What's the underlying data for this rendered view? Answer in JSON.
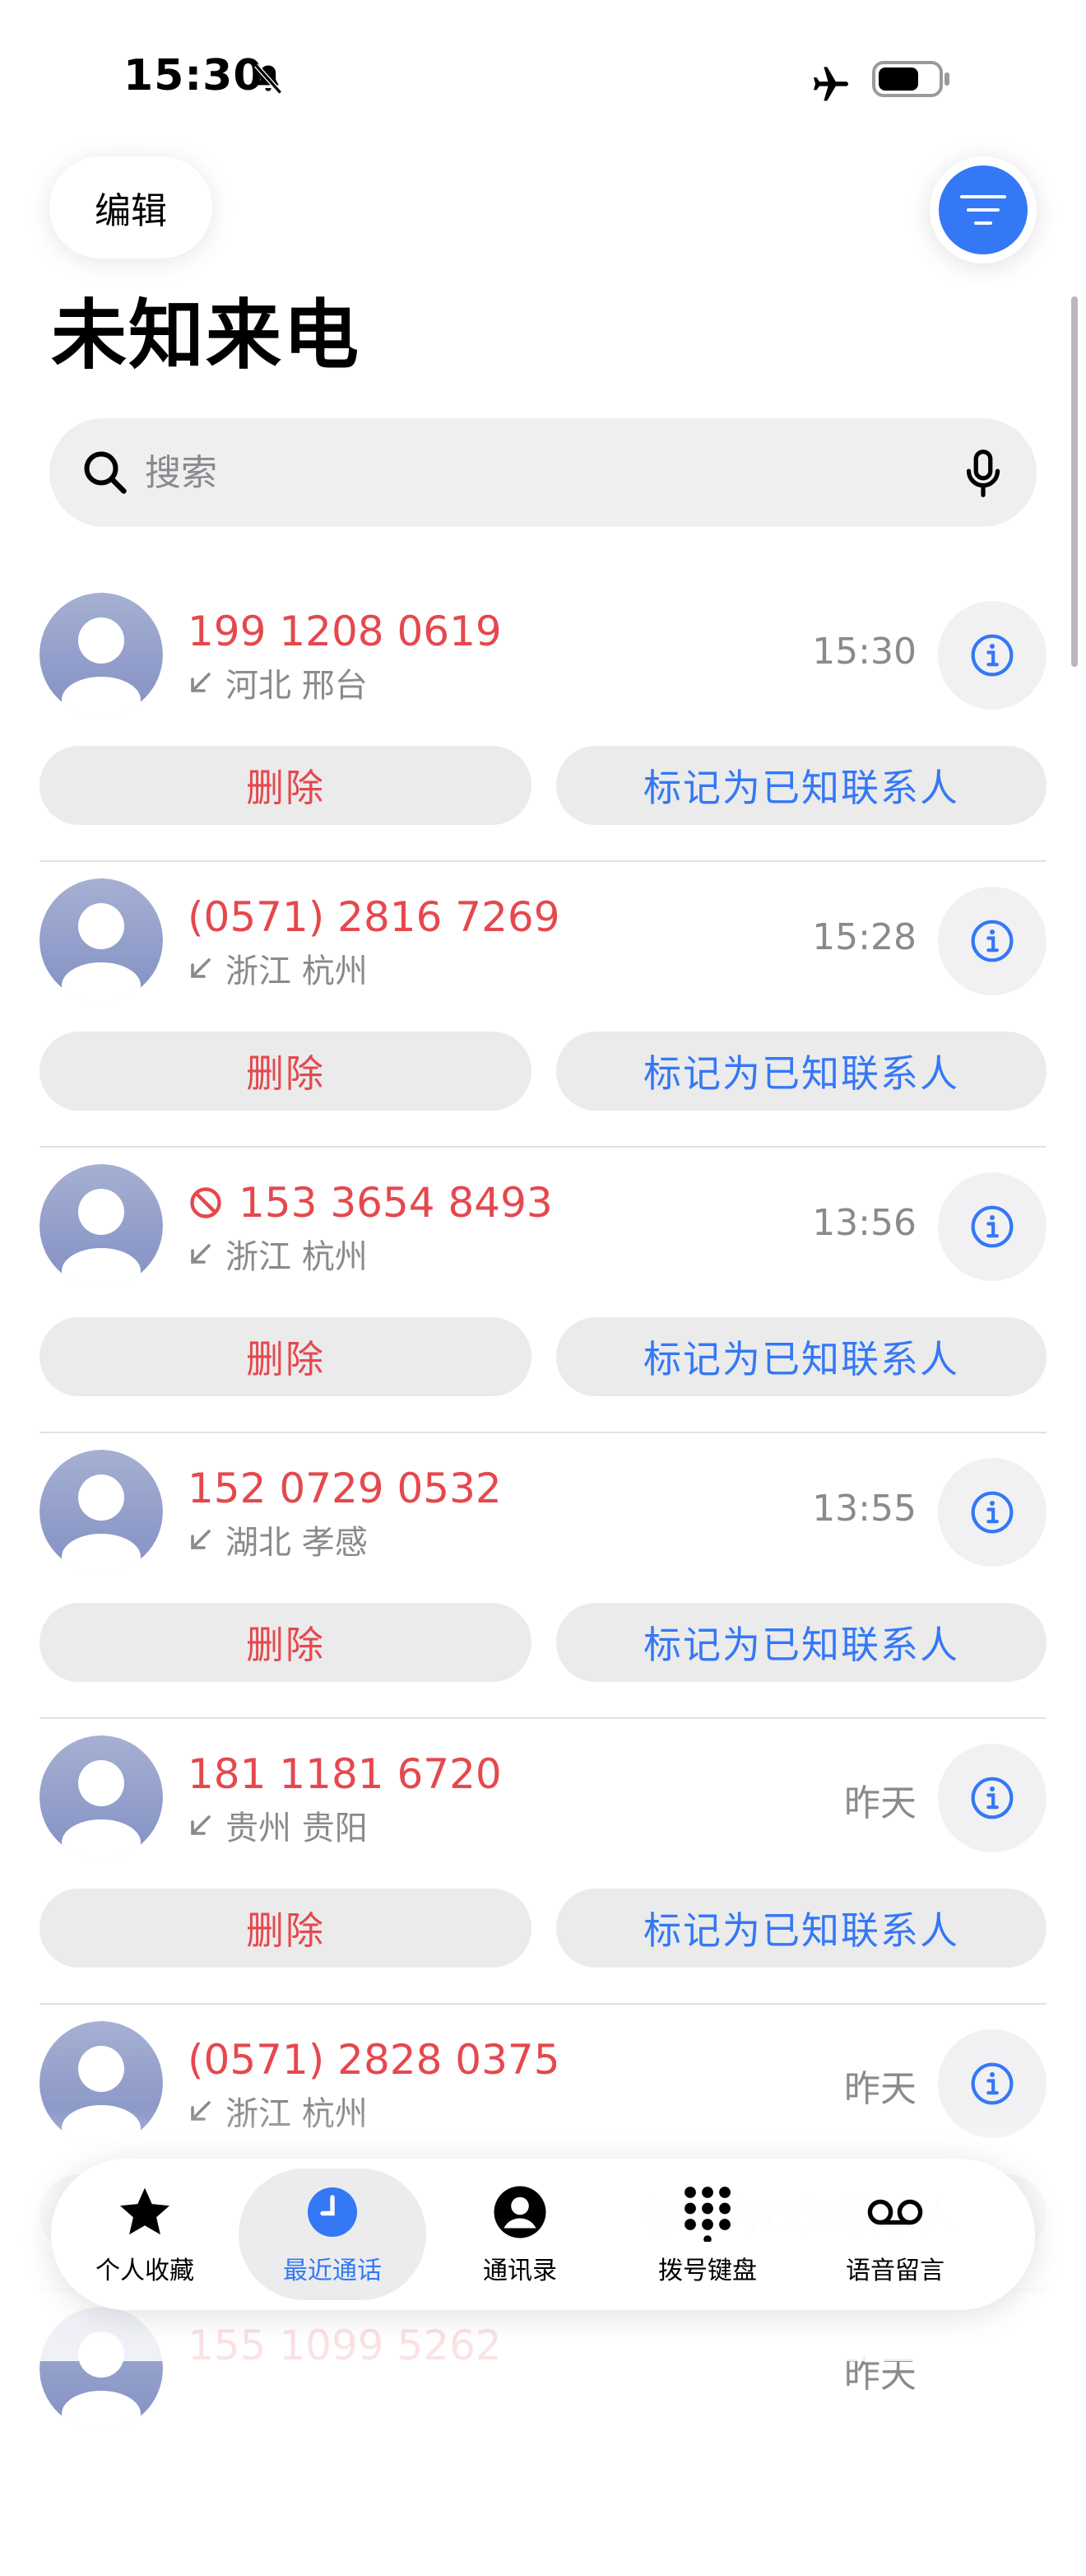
{
  "status_bar": {
    "time": "15:30",
    "icons": [
      "bell-off-icon",
      "airplane-icon",
      "battery-icon"
    ]
  },
  "header": {
    "edit_label": "编辑",
    "filter_icon": "filter-lines-icon",
    "title": "未知来电"
  },
  "search": {
    "placeholder": "搜索",
    "value": ""
  },
  "actions": {
    "delete_label": "删除",
    "mark_known_label": "标记为已知联系人"
  },
  "calls": [
    {
      "number": "199 1208 0619",
      "location": "河北 邢台",
      "time": "15:30",
      "blocked": false
    },
    {
      "number": "(0571) 2816 7269",
      "location": "浙江 杭州",
      "time": "15:28",
      "blocked": false
    },
    {
      "number": "153 3654 8493",
      "location": "浙江 杭州",
      "time": "13:56",
      "blocked": true
    },
    {
      "number": "152 0729 0532",
      "location": "湖北 孝感",
      "time": "13:55",
      "blocked": false
    },
    {
      "number": "181 1181 6720",
      "location": "贵州 贵阳",
      "time": "昨天",
      "blocked": false
    },
    {
      "number": "(0571) 2828 0375",
      "location": "浙江 杭州",
      "time": "昨天",
      "blocked": false
    },
    {
      "number": "155 1099 5262",
      "location": "",
      "time": "昨天",
      "blocked": false
    }
  ],
  "tabs": [
    {
      "label": "个人收藏",
      "icon": "star-icon",
      "active": false
    },
    {
      "label": "最近通话",
      "icon": "clock-icon",
      "active": true
    },
    {
      "label": "通讯录",
      "icon": "person-circle-icon",
      "active": false
    },
    {
      "label": "拨号键盘",
      "icon": "keypad-icon",
      "active": false
    },
    {
      "label": "语音留言",
      "icon": "voicemail-icon",
      "active": false
    }
  ],
  "colors": {
    "accent": "#3478f6",
    "missed_red": "#e5484d",
    "secondary_text": "#8a8a8e",
    "button_bg": "#ebebec"
  }
}
